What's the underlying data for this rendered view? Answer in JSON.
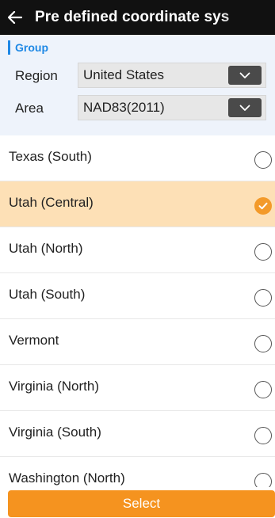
{
  "header": {
    "title": "Pre defined coordinate sys",
    "back_icon": "arrow-left-icon"
  },
  "group": {
    "label": "Group",
    "accent": "#1e88e5",
    "region_label": "Region",
    "region_value": "United States",
    "area_label": "Area",
    "area_value": "NAD83(2011)",
    "dropdown_icon": "chevron-down-icon"
  },
  "list": {
    "items": [
      {
        "label": "Texas (South)",
        "selected": false
      },
      {
        "label": "Utah (Central)",
        "selected": true
      },
      {
        "label": "Utah (North)",
        "selected": false
      },
      {
        "label": "Utah (South)",
        "selected": false
      },
      {
        "label": "Vermont",
        "selected": false
      },
      {
        "label": "Virginia (North)",
        "selected": false
      },
      {
        "label": "Virginia (South)",
        "selected": false
      },
      {
        "label": "Washington (North)",
        "selected": false
      }
    ],
    "selected_color": "#fde0b6",
    "check_color": "#f39a2a"
  },
  "footer": {
    "select_label": "Select",
    "accent": "#f5931f"
  }
}
